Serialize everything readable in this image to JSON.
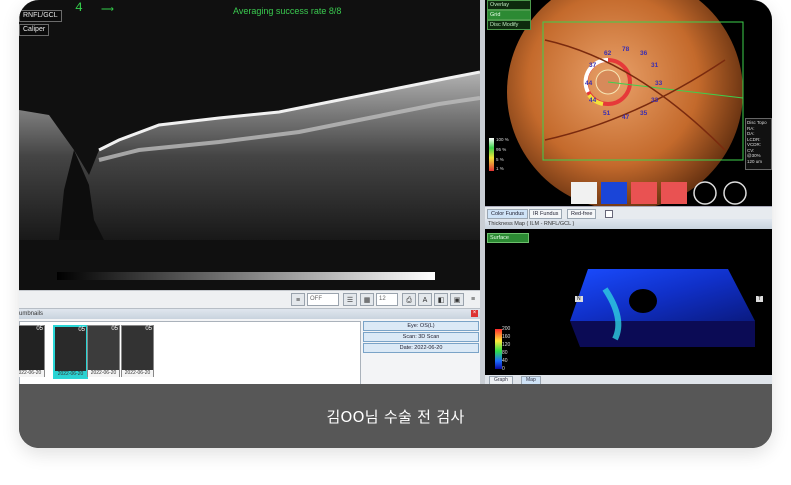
{
  "oct": {
    "labels": [
      "RNFL/GCL",
      "Caliper"
    ],
    "slice_number": "4",
    "avg_text": "Averaging success rate  8/8"
  },
  "toolbar": {
    "off_select": "OFF",
    "zoom_select": "12"
  },
  "thumbnails": {
    "header": "umbnails",
    "items": [
      {
        "num": "05",
        "date": "2022-06-20"
      },
      {
        "num": "05",
        "date": "2022-06-20"
      },
      {
        "num": "05",
        "date": "2022-06-20"
      },
      {
        "num": "05",
        "date": "2022-06-20"
      }
    ],
    "info": {
      "eye": "Eye: OS(L)",
      "scan": "Scan: 3D Scan",
      "date": "Date: 2022-06-20"
    }
  },
  "fundus": {
    "overlay_buttons": [
      "Overlay",
      "Grid",
      "Disc Modify"
    ],
    "ring_values": [
      "78",
      "62",
      "36",
      "37",
      "31",
      "44",
      "33",
      "44",
      "33",
      "51",
      "47",
      "35"
    ],
    "scale_labels": [
      "100 %",
      "95 %",
      "5 %",
      "1 %"
    ],
    "disc_info": [
      "Disc Topo",
      "RA:",
      "DA:",
      "LCDR:",
      "VCDR:",
      "CV:",
      "@30%",
      "120 um"
    ],
    "tabs": [
      "Color Fundus",
      "IR Fundus",
      "Red-free"
    ]
  },
  "thickness": {
    "header": "Thickness Map  ( ILM - RNFL/GCL )",
    "surface_button": "Surface",
    "scale": [
      "200",
      "160",
      "120",
      "80",
      "40",
      "0"
    ],
    "nav_labels": [
      "N",
      "T"
    ],
    "bottom_tabs": [
      "Graph",
      "Map"
    ]
  },
  "caption": "김OO님 수술 전 검사",
  "colors": {
    "caption_bg": "#575757",
    "accent_green": "#2c8a33",
    "oct_text": "#34d04c"
  }
}
